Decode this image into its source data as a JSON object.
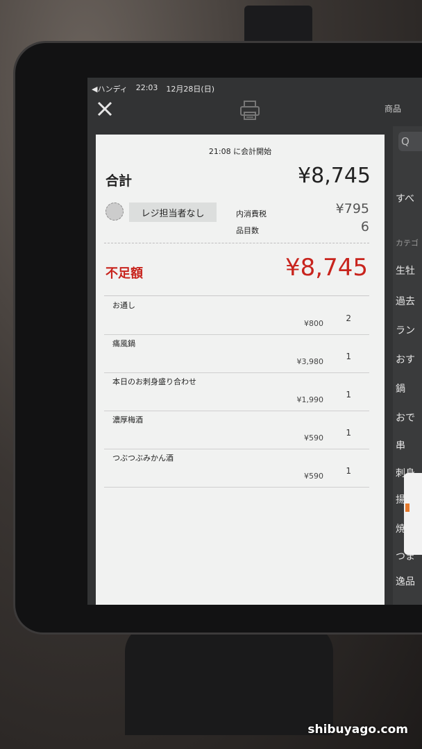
{
  "status_bar": {
    "carrier": "◀ハンディ",
    "time": "22:03",
    "date": "12月28日(日)"
  },
  "top_bar": {
    "close_icon": "close-icon",
    "print_icon": "printer-icon",
    "right_header": "商品"
  },
  "right_panel": {
    "search_glyph": "Q",
    "categories": [
      {
        "label": "すべ"
      },
      {
        "label": "カテゴ",
        "small": true
      },
      {
        "label": "生牡"
      },
      {
        "label": "過去"
      },
      {
        "label": "ラン"
      },
      {
        "label": "おす"
      },
      {
        "label": "鍋"
      },
      {
        "label": "おで"
      },
      {
        "label": "串"
      },
      {
        "label": "刺身"
      },
      {
        "label": "揚げ"
      },
      {
        "label": "焼き"
      },
      {
        "label": "つま"
      },
      {
        "label": "逸品"
      }
    ]
  },
  "receipt": {
    "start_time": "21:08 に会計開始",
    "total_label": "合計",
    "total_value": "¥8,745",
    "cashier_label": "レジ担当者なし",
    "tax_label": "内消費税",
    "tax_value": "¥795",
    "count_label": "品目数",
    "count_value": "6",
    "shortage_label": "不足額",
    "shortage_value": "¥8,745",
    "items": [
      {
        "name": "お通し",
        "price": "¥800",
        "qty": "2"
      },
      {
        "name": "痛風鍋",
        "price": "¥3,980",
        "qty": "1"
      },
      {
        "name": "本日のお刺身盛り合わせ",
        "price": "¥1,990",
        "qty": "1"
      },
      {
        "name": "濃厚梅酒",
        "price": "¥590",
        "qty": "1"
      },
      {
        "name": "つぶつぶみかん酒",
        "price": "¥590",
        "qty": "1"
      }
    ]
  },
  "watermark": "shibuyago.com",
  "colors": {
    "accent_red": "#c8241d",
    "panel_bg": "#f1f2f1",
    "screen_dark": "#323334"
  }
}
